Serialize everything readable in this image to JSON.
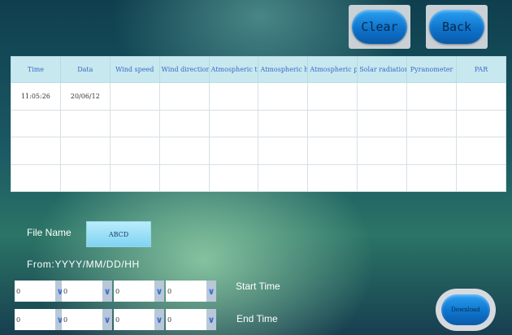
{
  "toolbar": {
    "clear_label": "Clear",
    "back_label": "Back"
  },
  "table": {
    "headers": [
      "Time",
      "Data",
      "Wind speed",
      "Wind direction",
      "Atmospheric temperature",
      "Atmospheric humidity",
      "Atmospheric pressure",
      "Solar radiation",
      "Pyranometer",
      "PAR"
    ],
    "rows": [
      [
        "11:05:26",
        "20/06/12",
        "",
        "",
        "",
        "",
        "",
        "",
        "",
        ""
      ],
      [
        "",
        "",
        "",
        "",
        "",
        "",
        "",
        "",
        "",
        ""
      ],
      [
        "",
        "",
        "",
        "",
        "",
        "",
        "",
        "",
        "",
        ""
      ],
      [
        "",
        "",
        "",
        "",
        "",
        "",
        "",
        "",
        "",
        ""
      ]
    ]
  },
  "file": {
    "label": "File Name",
    "value": "ABCD"
  },
  "from_label": "From:YYYY/MM/DD/HH",
  "start_time": {
    "label": "Start Time",
    "values": [
      "0",
      "0",
      "0",
      "0"
    ]
  },
  "end_time": {
    "label": "End Time",
    "values": [
      "0",
      "0",
      "0",
      "0"
    ]
  },
  "download_label": "Download",
  "colors": {
    "button_blue": "#0e74cc",
    "header_bg": "#c7e8ee",
    "header_text": "#3a69c8"
  }
}
